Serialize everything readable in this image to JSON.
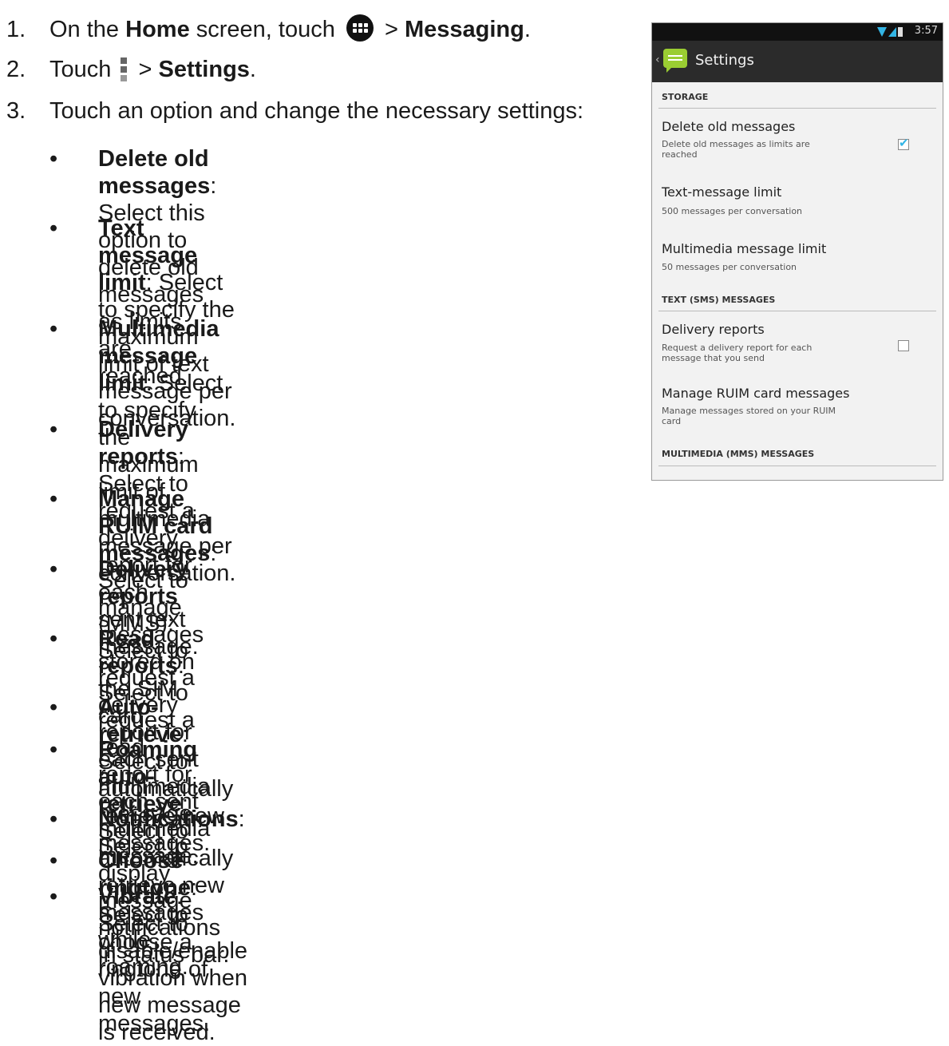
{
  "steps": [
    {
      "num": "1.",
      "pre": "On the ",
      "bold1": "Home",
      "mid": " screen, touch ",
      "post": " > ",
      "bold2": "Messaging",
      "end": ".",
      "icon": "apps-grid-icon"
    },
    {
      "num": "2.",
      "pre": "Touch ",
      "post": " > ",
      "bold": "Settings",
      "end": ".",
      "icon": "menu-dots-icon"
    },
    {
      "num": "3.",
      "text": "Touch an option and change the necessary settings:"
    }
  ],
  "bullet_symbol": "•",
  "bullets": [
    {
      "term": "Delete old messages",
      "desc_lines": [
        ": Select this option to",
        "delete old messages as limits are reached."
      ]
    },
    {
      "term": "Text message limit",
      "desc_lines": [
        ": Select to specify the",
        "maximum limit of text message per",
        "conversation."
      ]
    },
    {
      "term": "Multimedia message limit",
      "desc_lines": [
        ": Select to specify",
        "the maximum limit of multimedia message per",
        "conversation."
      ]
    },
    {
      "term": "Delivery reports",
      "desc_lines": [
        ": Select to request a delivery",
        "report for each sent text message."
      ]
    },
    {
      "term": "Manage RUIM card messages",
      "desc_lines": [
        ": Select to",
        "manage messages stored on the SIM card."
      ]
    },
    {
      "term": "Delivery reports",
      "desc_lines": [
        " (MMS): Select to request a delivery report for each sent",
        "multimedia message."
      ]
    },
    {
      "term": "Read reports",
      "desc_lines": [
        ": Select to request a read report for each sent multimedia",
        "message."
      ]
    },
    {
      "term": "Auto-retrieve",
      "desc_lines": [
        ": Select to automatically retrieve new messages."
      ]
    },
    {
      "term": "Roaming auto-retrieve",
      "desc_lines": [
        ": Select to automatically retrieve new messages",
        "while roaming."
      ]
    },
    {
      "term": "Notifications",
      "desc_lines": [
        ": Select to display message notifications in status bar."
      ]
    },
    {
      "term": "Choose ringtone",
      "desc_lines": [
        ": Select to choose a ringtone of new messages."
      ]
    },
    {
      "term": "Vibrate",
      "desc_lines": [
        ": Select to disable/enable vibration when new message is received."
      ]
    }
  ],
  "phone": {
    "status_time": "3:57",
    "title": "Settings",
    "sections": {
      "storage": "STORAGE",
      "text_sms": "TEXT (SMS) MESSAGES",
      "mms": "MULTIMEDIA (MMS) MESSAGES"
    },
    "items": [
      {
        "title": "Delete old messages",
        "summary_lines": [
          "Delete old messages as limits are",
          "reached"
        ],
        "checked": true
      },
      {
        "title": "Text-message limit",
        "summary_lines": [
          "500 messages per conversation"
        ]
      },
      {
        "title": "Multimedia message limit",
        "summary_lines": [
          "50 messages per conversation"
        ]
      },
      {
        "title": "Delivery reports",
        "summary_lines": [
          "Request a delivery report for each",
          "message that you send"
        ],
        "checked": false
      },
      {
        "title": "Manage RUIM card messages",
        "summary_lines": [
          "Manage messages stored on your RUIM",
          "card"
        ]
      }
    ]
  }
}
